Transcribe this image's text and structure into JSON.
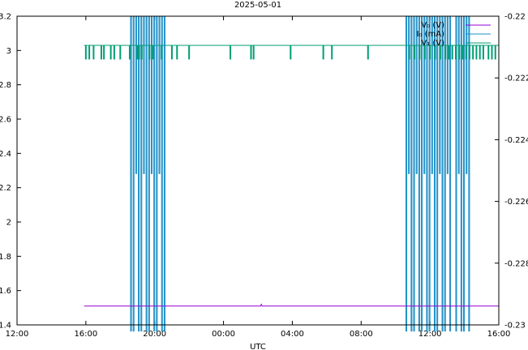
{
  "chart_data": {
    "type": "line",
    "title": "2025-05-01",
    "xlabel": "UTC",
    "ylabel_left": "",
    "ylabel_right": "",
    "x_ticks": [
      "12:00",
      "16:00",
      "20:00",
      "00:00",
      "04:00",
      "08:00",
      "12:00",
      "16:00"
    ],
    "x_range_hours": [
      0,
      28
    ],
    "y_left": {
      "ylim": [
        1.4,
        3.2
      ],
      "ticks": [
        "1.4",
        "1.6",
        "1.8",
        "2",
        "2.2",
        "2.4",
        "2.6",
        "2.8",
        "3",
        "3.2"
      ]
    },
    "y_right": {
      "ylim": [
        -0.23,
        -0.22
      ],
      "ticks": [
        "-0.23",
        "-0.228",
        "-0.226",
        "-0.224",
        "-0.222",
        "-0.22"
      ]
    },
    "grid": false,
    "legend_position": "top-right",
    "series": [
      {
        "name": "V₀ (V)",
        "color": "#9400d3",
        "axis": "left",
        "base": 1.51,
        "spikes": [
          {
            "x": 14.2,
            "y": 1.52
          }
        ],
        "x_range": [
          3.9,
          28.0
        ]
      },
      {
        "name": "I₀ (mA)",
        "color": "#1f8fc6",
        "axis": "right",
        "high": -0.2199,
        "low": -0.2302,
        "x_range": [
          3.9,
          28.0
        ],
        "bursts": [
          {
            "segments": [
              [
                6.6,
                6.65,
                "full"
              ],
              [
                6.75,
                6.8,
                "full"
              ],
              [
                6.9,
                6.95,
                "partial"
              ],
              [
                7.05,
                7.1,
                "full"
              ],
              [
                7.2,
                7.25,
                "full"
              ],
              [
                7.35,
                7.4,
                "partial"
              ],
              [
                7.5,
                7.55,
                "full"
              ],
              [
                7.65,
                7.7,
                "full"
              ],
              [
                7.8,
                7.85,
                "partial"
              ],
              [
                7.95,
                8.0,
                "full"
              ],
              [
                8.1,
                8.15,
                "full"
              ],
              [
                8.25,
                8.3,
                "partial"
              ],
              [
                8.4,
                8.45,
                "full"
              ],
              [
                8.55,
                8.6,
                "full"
              ]
            ]
          },
          {
            "segments": [
              [
                22.6,
                22.65,
                "full"
              ],
              [
                22.75,
                22.8,
                "partial"
              ],
              [
                22.9,
                22.95,
                "full"
              ],
              [
                23.05,
                23.1,
                "full"
              ],
              [
                23.2,
                23.25,
                "partial"
              ],
              [
                23.35,
                23.4,
                "full"
              ],
              [
                23.5,
                23.55,
                "full"
              ],
              [
                23.65,
                23.7,
                "partial"
              ],
              [
                23.8,
                23.85,
                "full"
              ],
              [
                23.95,
                24.0,
                "full"
              ],
              [
                24.1,
                24.15,
                "partial"
              ],
              [
                24.25,
                24.3,
                "full"
              ],
              [
                24.4,
                24.45,
                "full"
              ],
              [
                24.55,
                24.6,
                "partial"
              ],
              [
                24.7,
                24.75,
                "full"
              ],
              [
                24.85,
                24.9,
                "full"
              ],
              [
                25.0,
                25.05,
                "partial"
              ],
              [
                25.15,
                25.2,
                "full"
              ],
              [
                25.5,
                25.55,
                "full"
              ],
              [
                25.65,
                25.7,
                "partial"
              ],
              [
                25.8,
                25.85,
                "full"
              ],
              [
                25.95,
                26.0,
                "full"
              ],
              [
                26.1,
                26.15,
                "partial"
              ],
              [
                26.25,
                26.3,
                "full"
              ]
            ]
          }
        ],
        "partial_low": -0.2251
      },
      {
        "name": "V₁ (V)",
        "color": "#009e73",
        "axis": "left",
        "base": 3.03,
        "dip": 2.95,
        "x_range": [
          3.9,
          28.0
        ],
        "dips": [
          4.0,
          4.2,
          4.45,
          4.9,
          5.05,
          5.45,
          5.65,
          6.0,
          6.55,
          7.0,
          7.1,
          7.25,
          7.7,
          7.9,
          8.4,
          9.0,
          9.3,
          10.0,
          12.4,
          13.6,
          13.75,
          15.9,
          17.8,
          18.3,
          20.4,
          22.8,
          23.1,
          23.4,
          23.7,
          24.0,
          24.3,
          24.6,
          24.9,
          25.1,
          25.3,
          25.5,
          25.7,
          25.9,
          26.1,
          26.3,
          26.5,
          26.7,
          26.9,
          27.1,
          27.4,
          27.6,
          27.8
        ]
      }
    ]
  }
}
